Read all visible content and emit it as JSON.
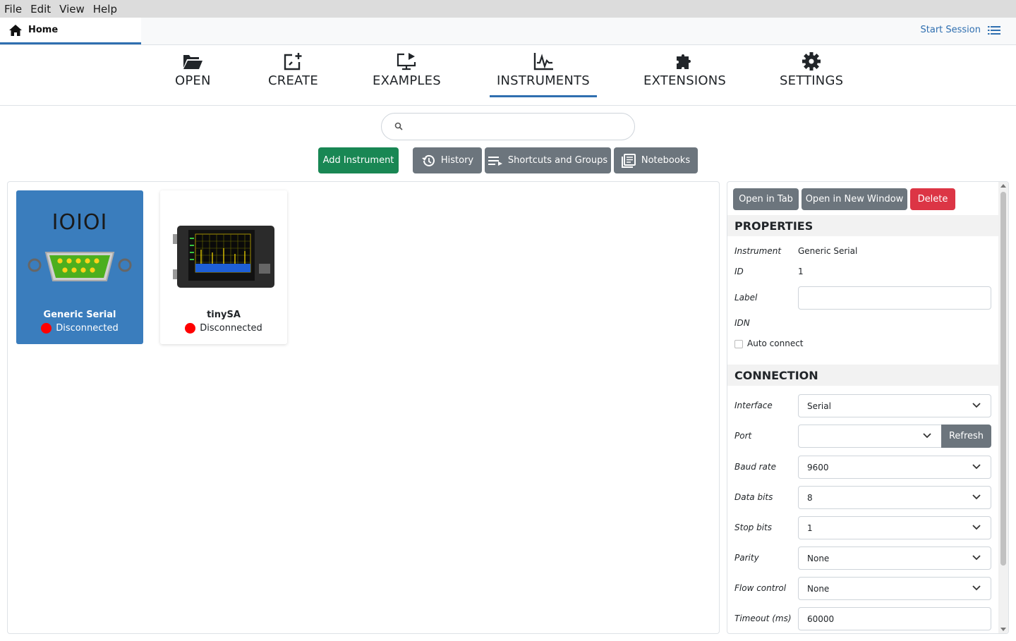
{
  "menubar": {
    "items": [
      "File",
      "Edit",
      "View",
      "Help"
    ]
  },
  "tabs": {
    "home_label": "Home",
    "start_session": "Start Session"
  },
  "nav": {
    "open": "OPEN",
    "create": "CREATE",
    "examples": "EXAMPLES",
    "instruments": "INSTRUMENTS",
    "extensions": "EXTENSIONS",
    "settings": "SETTINGS"
  },
  "search": {
    "value": "",
    "placeholder": ""
  },
  "actions": {
    "add_instrument": "Add Instrument",
    "history": "History",
    "shortcuts": "Shortcuts and Groups",
    "notebooks": "Notebooks"
  },
  "cards": [
    {
      "name": "Generic Serial",
      "status": "Disconnected",
      "logo_text": "IOIOI"
    },
    {
      "name": "tinySA",
      "status": "Disconnected"
    }
  ],
  "panel": {
    "open_in_tab": "Open in Tab",
    "open_in_new_window": "Open in New Window",
    "delete": "Delete",
    "properties_title": "PROPERTIES",
    "instrument_label": "Instrument",
    "instrument_value": "Generic Serial",
    "id_label": "ID",
    "id_value": "1",
    "label_label": "Label",
    "label_value": "",
    "idn_label": "IDN",
    "auto_connect": "Auto connect",
    "connection_title": "CONNECTION",
    "interface_label": "Interface",
    "interface_value": "Serial",
    "port_label": "Port",
    "port_value": "",
    "refresh": "Refresh",
    "baud_label": "Baud rate",
    "baud_value": "9600",
    "databits_label": "Data bits",
    "databits_value": "8",
    "stopbits_label": "Stop bits",
    "stopbits_value": "1",
    "parity_label": "Parity",
    "parity_value": "None",
    "flow_label": "Flow control",
    "flow_value": "None",
    "timeout_label": "Timeout (ms)",
    "timeout_value": "60000"
  },
  "colors": {
    "accent": "#2f6fb0",
    "green": "#198754",
    "gray": "#6c757d",
    "danger": "#dc3545",
    "status_red": "#ff0000"
  }
}
